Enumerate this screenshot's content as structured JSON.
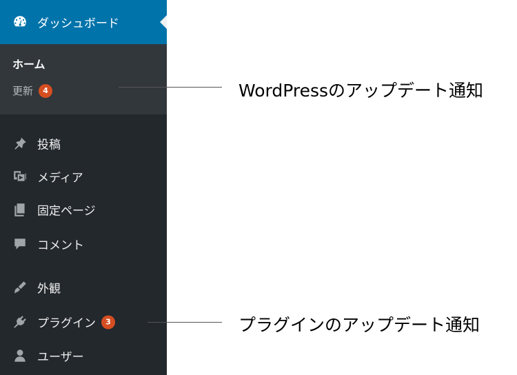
{
  "sidebar": {
    "dashboard": {
      "label": "ダッシュボード",
      "icon": "dashboard-icon"
    },
    "submenu": {
      "home_label": "ホーム",
      "update_label": "更新",
      "update_count": "4"
    },
    "items": [
      {
        "name": "posts",
        "label": "投稿",
        "icon": "pin-icon"
      },
      {
        "name": "media",
        "label": "メディア",
        "icon": "media-icon"
      },
      {
        "name": "pages",
        "label": "固定ページ",
        "icon": "page-icon"
      },
      {
        "name": "comments",
        "label": "コメント",
        "icon": "comment-icon"
      },
      {
        "name": "appearance",
        "label": "外観",
        "icon": "brush-icon"
      },
      {
        "name": "plugins",
        "label": "プラグイン",
        "icon": "plugin-icon",
        "badge": "3"
      },
      {
        "name": "users",
        "label": "ユーザー",
        "icon": "user-icon"
      }
    ]
  },
  "annotations": {
    "wordpress_update": "WordPressのアップデート通知",
    "plugin_update": "プラグインのアップデート通知"
  },
  "colors": {
    "sidebar_bg": "#23282d",
    "active_bg": "#0073aa",
    "submenu_bg": "#32373c",
    "badge_bg": "#d54e21"
  }
}
